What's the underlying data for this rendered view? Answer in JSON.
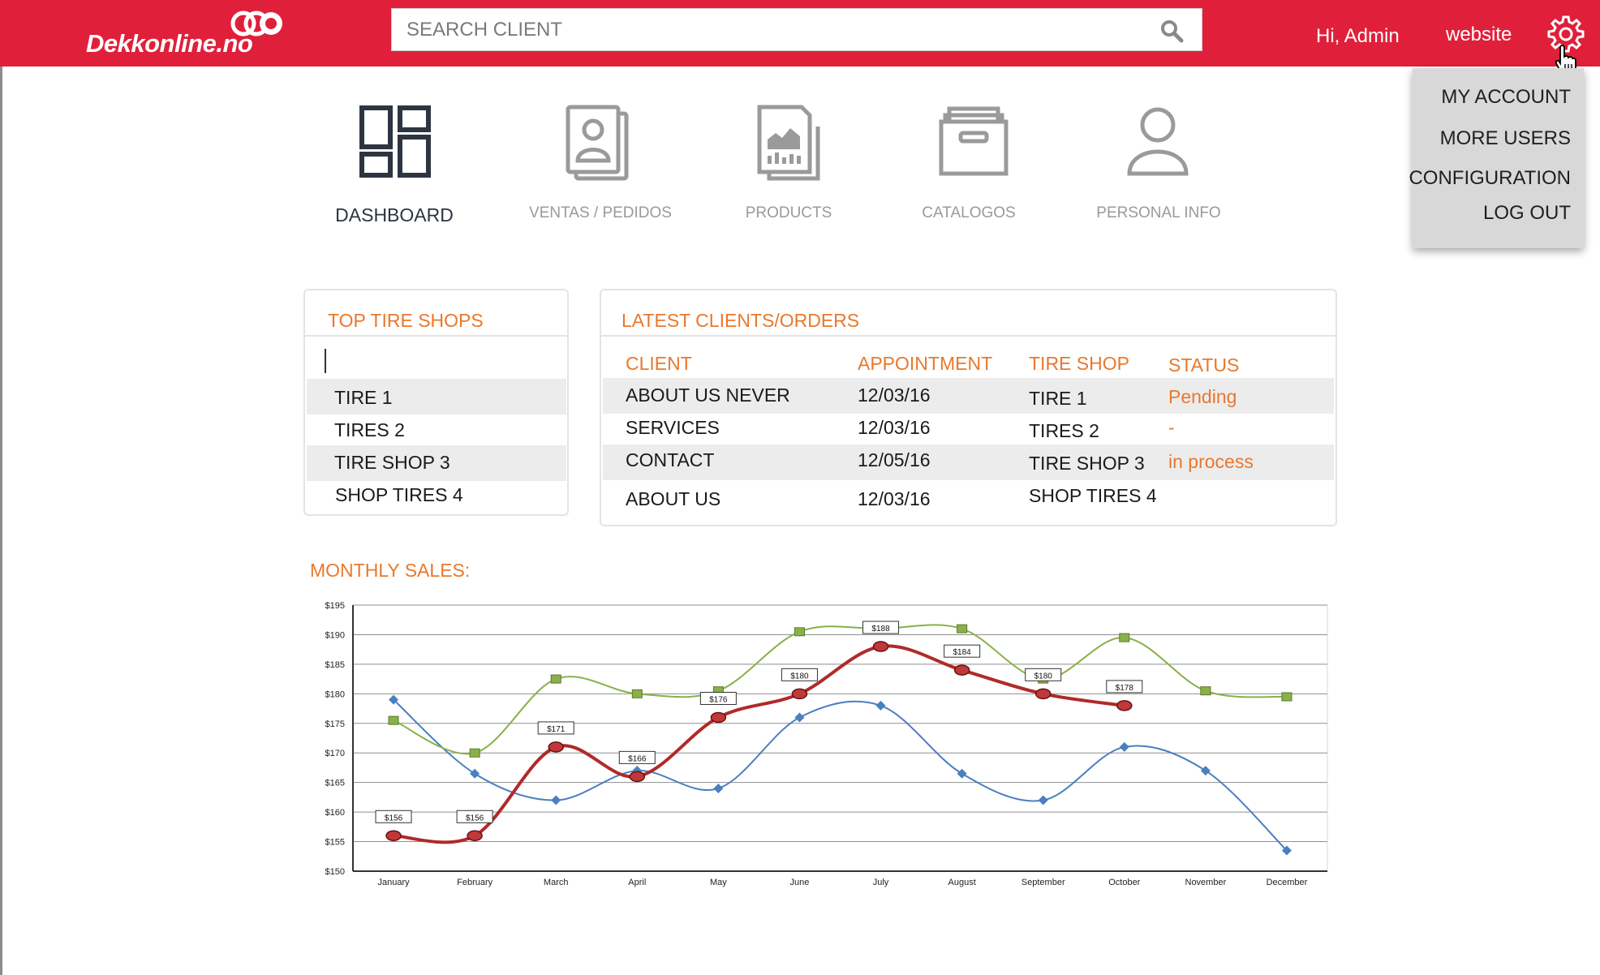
{
  "header": {
    "logo_text": "Dekkonline.no",
    "search_placeholder": "SEARCH CLIENT",
    "greeting": "Hi, Admin",
    "website_link": "website"
  },
  "settings_menu": {
    "items": [
      "MY ACCOUNT",
      "MORE USERS",
      "CONFIGURATION",
      "LOG OUT"
    ]
  },
  "nav": {
    "items": [
      {
        "label": "DASHBOARD",
        "icon": "dashboard-icon",
        "active": true
      },
      {
        "label": "VENTAS / PEDIDOS",
        "icon": "contacts-icon",
        "active": false
      },
      {
        "label": "PRODUCTS",
        "icon": "products-chart-icon",
        "active": false
      },
      {
        "label": "CATALOGOS",
        "icon": "archive-box-icon",
        "active": false
      },
      {
        "label": "PERSONAL INFO",
        "icon": "user-icon",
        "active": false
      }
    ]
  },
  "top_shops": {
    "title": "TOP TIRE SHOPS",
    "filter_value": "",
    "items": [
      "TIRE 1",
      "TIRES 2",
      "TIRE SHOP 3",
      "SHOP TIRES 4"
    ]
  },
  "latest": {
    "title": "LATEST CLIENTS/ORDERS",
    "columns": [
      "CLIENT",
      "APPOINTMENT",
      "TIRE SHOP",
      "STATUS"
    ],
    "rows": [
      {
        "client": "ABOUT US NEVER",
        "appointment": "12/03/16",
        "shop": "TIRE 1",
        "status": "Pending"
      },
      {
        "client": "SERVICES",
        "appointment": "12/03/16",
        "shop": "TIRES 2",
        "status": "-"
      },
      {
        "client": "CONTACT",
        "appointment": "12/05/16",
        "shop": "TIRE SHOP 3",
        "status": "in process"
      },
      {
        "client": "ABOUT US",
        "appointment": "12/03/16",
        "shop": "SHOP TIRES 4",
        "status": ""
      }
    ]
  },
  "sales": {
    "title": "MONTHLY SALES:"
  },
  "colors": {
    "brand_red": "#e0203a",
    "accent_orange": "#e9782c",
    "series_red": "#b02a2a",
    "series_green": "#8ab04a",
    "series_blue": "#4a7fc0"
  },
  "chart_data": {
    "type": "line",
    "categories": [
      "January",
      "February",
      "March",
      "April",
      "May",
      "June",
      "July",
      "August",
      "September",
      "October",
      "November",
      "December"
    ],
    "ylim": [
      150,
      195
    ],
    "yticks": [
      "$150",
      "$155",
      "$160",
      "$165",
      "$170",
      "$175",
      "$180",
      "$185",
      "$190",
      "$195"
    ],
    "grid": true,
    "series": [
      {
        "color": "#b02a2a",
        "values": [
          156,
          156,
          171,
          166,
          176,
          180,
          188,
          184,
          180,
          178,
          null,
          null
        ],
        "labels": [
          "$156",
          "$156",
          "$171",
          "$166",
          "$176",
          "$180",
          "$188",
          "$184",
          "$180",
          "$178"
        ]
      },
      {
        "color": "#8ab04a",
        "values": [
          175.5,
          170,
          182.5,
          180,
          180.5,
          190.5,
          191,
          191,
          182.5,
          189.5,
          180.5,
          179.5
        ]
      },
      {
        "color": "#4a7fc0",
        "values": [
          179,
          166.5,
          162,
          167,
          164,
          176,
          178,
          166.5,
          162,
          171,
          167,
          153.5
        ]
      }
    ]
  }
}
